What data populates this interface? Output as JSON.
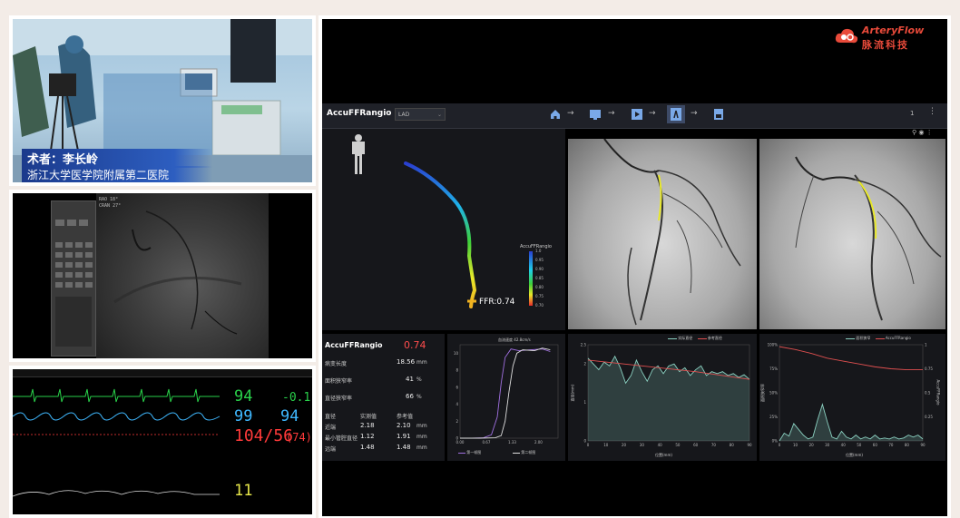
{
  "or_camera": {
    "surgeon": "术者：李长岭",
    "hospital": "浙江大学医学院附属第二医院"
  },
  "fluoro": {
    "rao": "RAO",
    "rao_val": "18°",
    "cran": "CRAN",
    "cran_val": "27°"
  },
  "monitor": {
    "hr": "94",
    "st": "-0.1",
    "spo2": "99",
    "pr": "94",
    "nibp": "104/56",
    "map": "(74)",
    "resp": "11"
  },
  "brand": {
    "name": "ArteryFlow",
    "cn": "脉流科技"
  },
  "app": {
    "title": "AccuFFRangio",
    "series": "LAD",
    "page": "1",
    "ffr_label": "FFR:0.74",
    "colorbar_title": "AccuFFRangio",
    "colorbar_ticks": [
      "1.0",
      "0.95",
      "0.90",
      "0.85",
      "0.80",
      "0.75",
      "0.70"
    ]
  },
  "results": {
    "title": "AccuFFRangio",
    "value": "0.74",
    "length_label": "病变长度",
    "length_val": "18.56",
    "length_unit": "mm",
    "area_label": "面积狭窄率",
    "area_val": "41",
    "area_unit": "%",
    "diam_label": "直径狭窄率",
    "diam_val": "66",
    "diam_unit": "%",
    "hdr_cat": "直径",
    "hdr_meas": "实测值",
    "hdr_ref": "参考值",
    "rows": [
      {
        "label": "近端",
        "meas": "2.18",
        "ref": "2.10",
        "unit": "mm"
      },
      {
        "label": "最小管腔直径",
        "meas": "1.12",
        "ref": "1.91",
        "unit": "mm"
      },
      {
        "label": "远端",
        "meas": "1.48",
        "ref": "1.48",
        "unit": "mm"
      }
    ]
  },
  "charts": {
    "c1_note": "血流速度 42.8cm/s",
    "c1_legend": [
      "第一帧图",
      "第二帧图"
    ],
    "c2_legend": [
      "实际直径",
      "参考直径"
    ],
    "c2_xlabel": "位置(mm)",
    "c2_ylabel": "直径(mm)",
    "c3_legend": [
      "面积狭窄",
      "AccuFFRangio"
    ],
    "c3_xlabel": "位置(mm)",
    "c3_ylabel": "面积狭窄率",
    "c3_ylabel_right": "AccuFFRangio"
  },
  "chart_data": [
    {
      "type": "line",
      "x_ticks": [
        "0.00",
        "0.67",
        "1.33",
        "2.00"
      ],
      "y_ticks": [
        "0",
        "2",
        "4",
        "6",
        "8",
        "10"
      ],
      "xlim": [
        0,
        2.5
      ],
      "ylim": [
        0,
        11
      ],
      "series": [
        {
          "name": "第一帧图",
          "x": [
            0.0,
            0.3,
            0.6,
            0.8,
            0.95,
            1.05,
            1.15,
            1.3,
            1.5,
            1.8,
            2.1,
            2.3
          ],
          "y": [
            0.0,
            0.0,
            0.05,
            0.4,
            2.5,
            6.5,
            9.5,
            10.5,
            10.3,
            10.4,
            10.5,
            10.2
          ]
        },
        {
          "name": "第二帧图",
          "x": [
            0.0,
            0.5,
            0.9,
            1.05,
            1.15,
            1.25,
            1.35,
            1.45,
            1.6,
            1.9,
            2.1,
            2.3
          ],
          "y": [
            0.0,
            0.0,
            0.05,
            0.3,
            2.0,
            5.5,
            8.5,
            10.0,
            10.4,
            10.3,
            10.6,
            10.4
          ]
        }
      ]
    },
    {
      "type": "line",
      "x_ticks": [
        "0",
        "10",
        "20",
        "30",
        "40",
        "50",
        "60",
        "70",
        "80",
        "90"
      ],
      "y_ticks": [
        "0",
        "1",
        "2",
        "2.5"
      ],
      "xlim": [
        0,
        90
      ],
      "ylim": [
        0,
        2.5
      ],
      "series": [
        {
          "name": "实际直径",
          "x": [
            0,
            3,
            6,
            9,
            12,
            15,
            18,
            21,
            24,
            27,
            30,
            33,
            36,
            39,
            42,
            45,
            48,
            51,
            54,
            57,
            60,
            63,
            66,
            69,
            72,
            75,
            78,
            81,
            84,
            87,
            90
          ],
          "y": [
            2.15,
            2.0,
            1.85,
            2.05,
            1.95,
            2.2,
            1.9,
            1.5,
            1.7,
            2.1,
            1.8,
            1.55,
            1.85,
            1.95,
            1.75,
            1.95,
            2.0,
            1.8,
            1.9,
            1.7,
            1.85,
            1.95,
            1.7,
            1.8,
            1.75,
            1.8,
            1.7,
            1.75,
            1.65,
            1.72,
            1.6
          ]
        },
        {
          "name": "参考直径",
          "x": [
            0,
            30,
            60,
            90
          ],
          "y": [
            2.1,
            1.95,
            1.8,
            1.6
          ]
        }
      ]
    },
    {
      "type": "line",
      "x_ticks": [
        "0",
        "10",
        "20",
        "30",
        "40",
        "50",
        "60",
        "70",
        "80",
        "90"
      ],
      "y_ticks": [
        "0%",
        "25%",
        "50%",
        "75%",
        "100%"
      ],
      "y_ticks_right": [
        "0.25",
        "0.5",
        "0.75",
        "1"
      ],
      "xlim": [
        0,
        90
      ],
      "ylim": [
        0,
        100
      ],
      "series": [
        {
          "name": "面积狭窄",
          "x": [
            0,
            3,
            6,
            9,
            12,
            15,
            18,
            21,
            24,
            27,
            30,
            33,
            36,
            39,
            42,
            45,
            48,
            51,
            54,
            57,
            60,
            63,
            66,
            69,
            72,
            75,
            78,
            81,
            84,
            87,
            90
          ],
          "y": [
            0,
            8,
            5,
            18,
            12,
            6,
            2,
            4,
            22,
            38,
            20,
            4,
            2,
            10,
            4,
            2,
            6,
            2,
            4,
            2,
            6,
            2,
            3,
            2,
            4,
            2,
            3,
            6,
            4,
            6,
            2
          ]
        },
        {
          "name": "AccuFFRangio",
          "x": [
            0,
            10,
            20,
            30,
            40,
            50,
            60,
            70,
            80,
            90
          ],
          "y": [
            98,
            95,
            91,
            86,
            83,
            80,
            77,
            75,
            74,
            74
          ]
        }
      ]
    }
  ]
}
